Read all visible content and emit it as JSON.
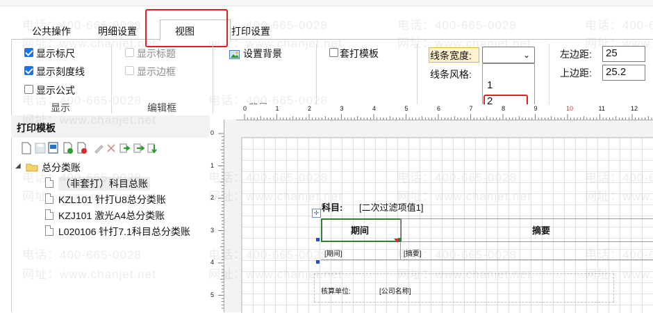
{
  "tabs": [
    {
      "label": "公共操作"
    },
    {
      "label": "明细设置"
    },
    {
      "label": "视图"
    },
    {
      "label": "打印设置"
    }
  ],
  "view_group": {
    "caption": "显示",
    "show_ruler": "显示标尺",
    "show_scale_lines": "显示刻度线",
    "show_formula": "显示公式"
  },
  "edit_group": {
    "caption": "编辑框",
    "show_title": "显示标题",
    "show_border": "显示边框"
  },
  "background": {
    "label": "设置背景",
    "label_cut": "背景"
  },
  "overlay_template": {
    "label": "套打模板"
  },
  "line": {
    "width_label": "线条宽度:",
    "style_label": "线条风格:",
    "selected_width": "",
    "options": [
      "1",
      "2"
    ]
  },
  "margins": {
    "left_label": "左边距:",
    "left_value": "25",
    "top_label": "上边距:",
    "top_value": "25.2"
  },
  "template_panel": {
    "title": "打印模板",
    "root": "总分类账",
    "items": [
      "（非套打）科目总账",
      "KZL101 针打U8总分类账",
      "KZJ101 激光A4总分类账",
      "L020106 针打7.1科目总分类账"
    ]
  },
  "ruler": {
    "top_numbers": [
      "0",
      "1",
      "2",
      "3",
      "4",
      "5",
      "6",
      "7",
      "8",
      "9",
      "10",
      "11",
      "12"
    ],
    "left_numbers": [
      "0",
      "1",
      "2",
      "3",
      "4",
      "5"
    ]
  },
  "report": {
    "subject_label": "科目:",
    "subject_value": "[二次过滤项值1]",
    "col_period": "期间",
    "col_summary": "摘要",
    "cell_period": "[期间]",
    "cell_summary": "[摘要]",
    "unit_label": "核算单位:",
    "unit_value": "[公司名称]"
  },
  "watermark": {
    "phone": "电话：400-665-0028",
    "site": "网址：www.chanjet.net"
  },
  "colors": {
    "highlight_red": "#e02020",
    "checkbox_blue": "#1a73e8",
    "selected_cell_border": "#2e7d32"
  }
}
